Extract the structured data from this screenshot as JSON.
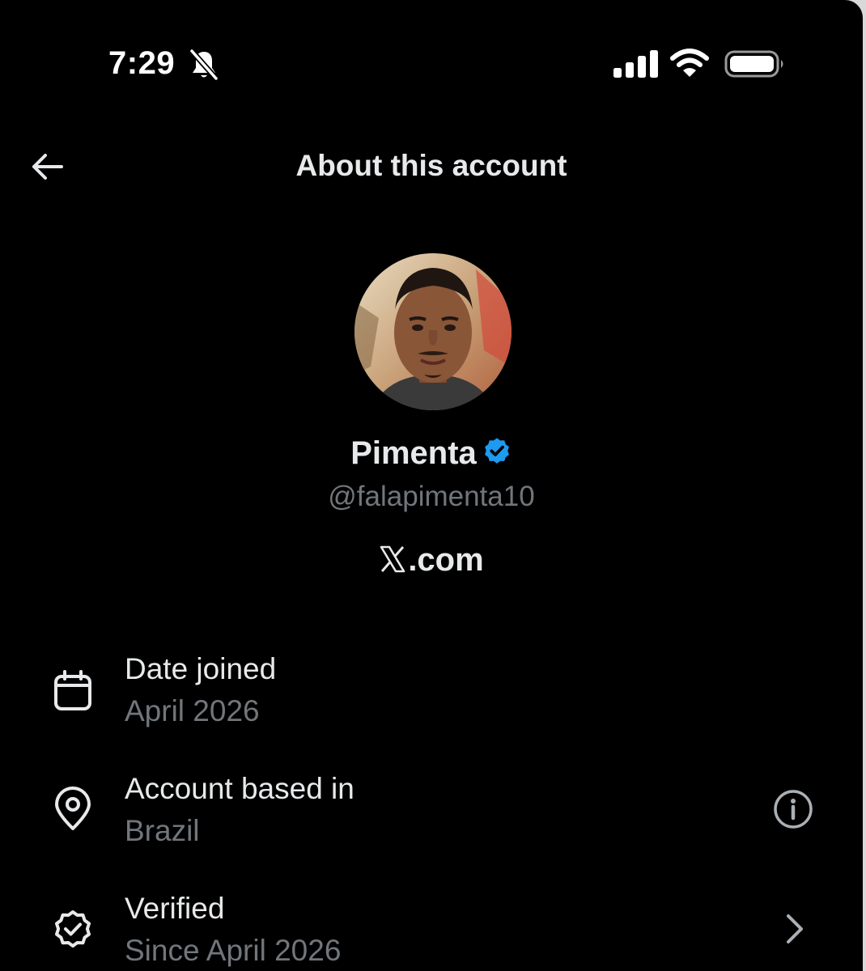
{
  "status_bar": {
    "time": "7:29",
    "icons": [
      "bell-slash-icon",
      "cellular-signal-icon",
      "wifi-icon",
      "battery-icon"
    ]
  },
  "header": {
    "back_icon": "arrow-left-icon",
    "title": "About this account"
  },
  "profile": {
    "name": "Pimenta",
    "verified": true,
    "verified_color": "#1d9bf0",
    "handle": "@falapimenta10",
    "platform_domain": ".com",
    "platform_logo": "x-logo-icon"
  },
  "info_rows": [
    {
      "icon": "calendar-icon",
      "label": "Date joined",
      "value": "April 2026"
    },
    {
      "icon": "location-pin-icon",
      "label": "Account based in",
      "value": "Brazil",
      "trailing_icon": "info-icon"
    },
    {
      "icon": "verified-badge-outline-icon",
      "label": "Verified",
      "value": "Since April 2026",
      "trailing_icon": "chevron-right-icon"
    }
  ],
  "colors": {
    "background": "#000000",
    "primary_text": "#e7e9ea",
    "secondary_text": "#71767b",
    "accent": "#1d9bf0"
  }
}
